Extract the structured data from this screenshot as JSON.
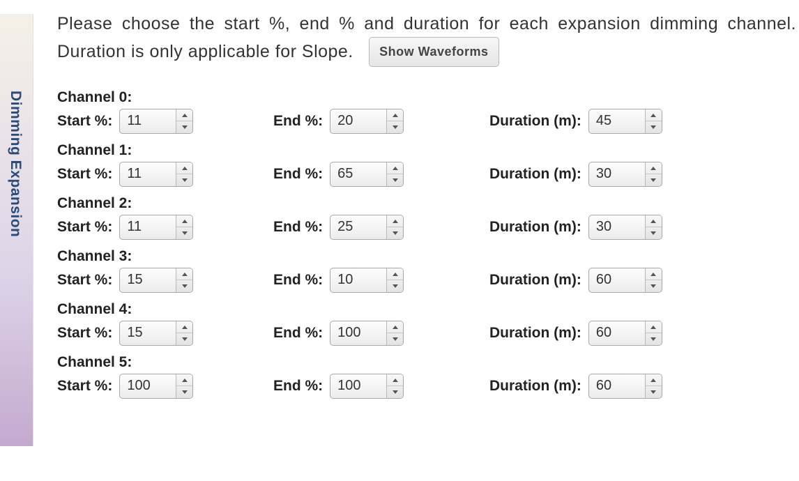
{
  "sidebar": {
    "label": "Dimming Expansion"
  },
  "instructions": "Please choose the start %, end % and duration for each expansion dimming channel. Duration is only applicable for Slope.",
  "buttons": {
    "show_waveforms": "Show Waveforms"
  },
  "labels": {
    "start": "Start %:",
    "end": "End %:",
    "duration": "Duration (m):",
    "channel_prefix": "Channel"
  },
  "channels": [
    {
      "name": "Channel 0:",
      "start": "11",
      "end": "20",
      "duration": "45"
    },
    {
      "name": "Channel 1:",
      "start": "11",
      "end": "65",
      "duration": "30"
    },
    {
      "name": "Channel 2:",
      "start": "11",
      "end": "25",
      "duration": "30"
    },
    {
      "name": "Channel 3:",
      "start": "15",
      "end": "10",
      "duration": "60"
    },
    {
      "name": "Channel 4:",
      "start": "15",
      "end": "100",
      "duration": "60"
    },
    {
      "name": "Channel 5:",
      "start": "100",
      "end": "100",
      "duration": "60"
    }
  ]
}
